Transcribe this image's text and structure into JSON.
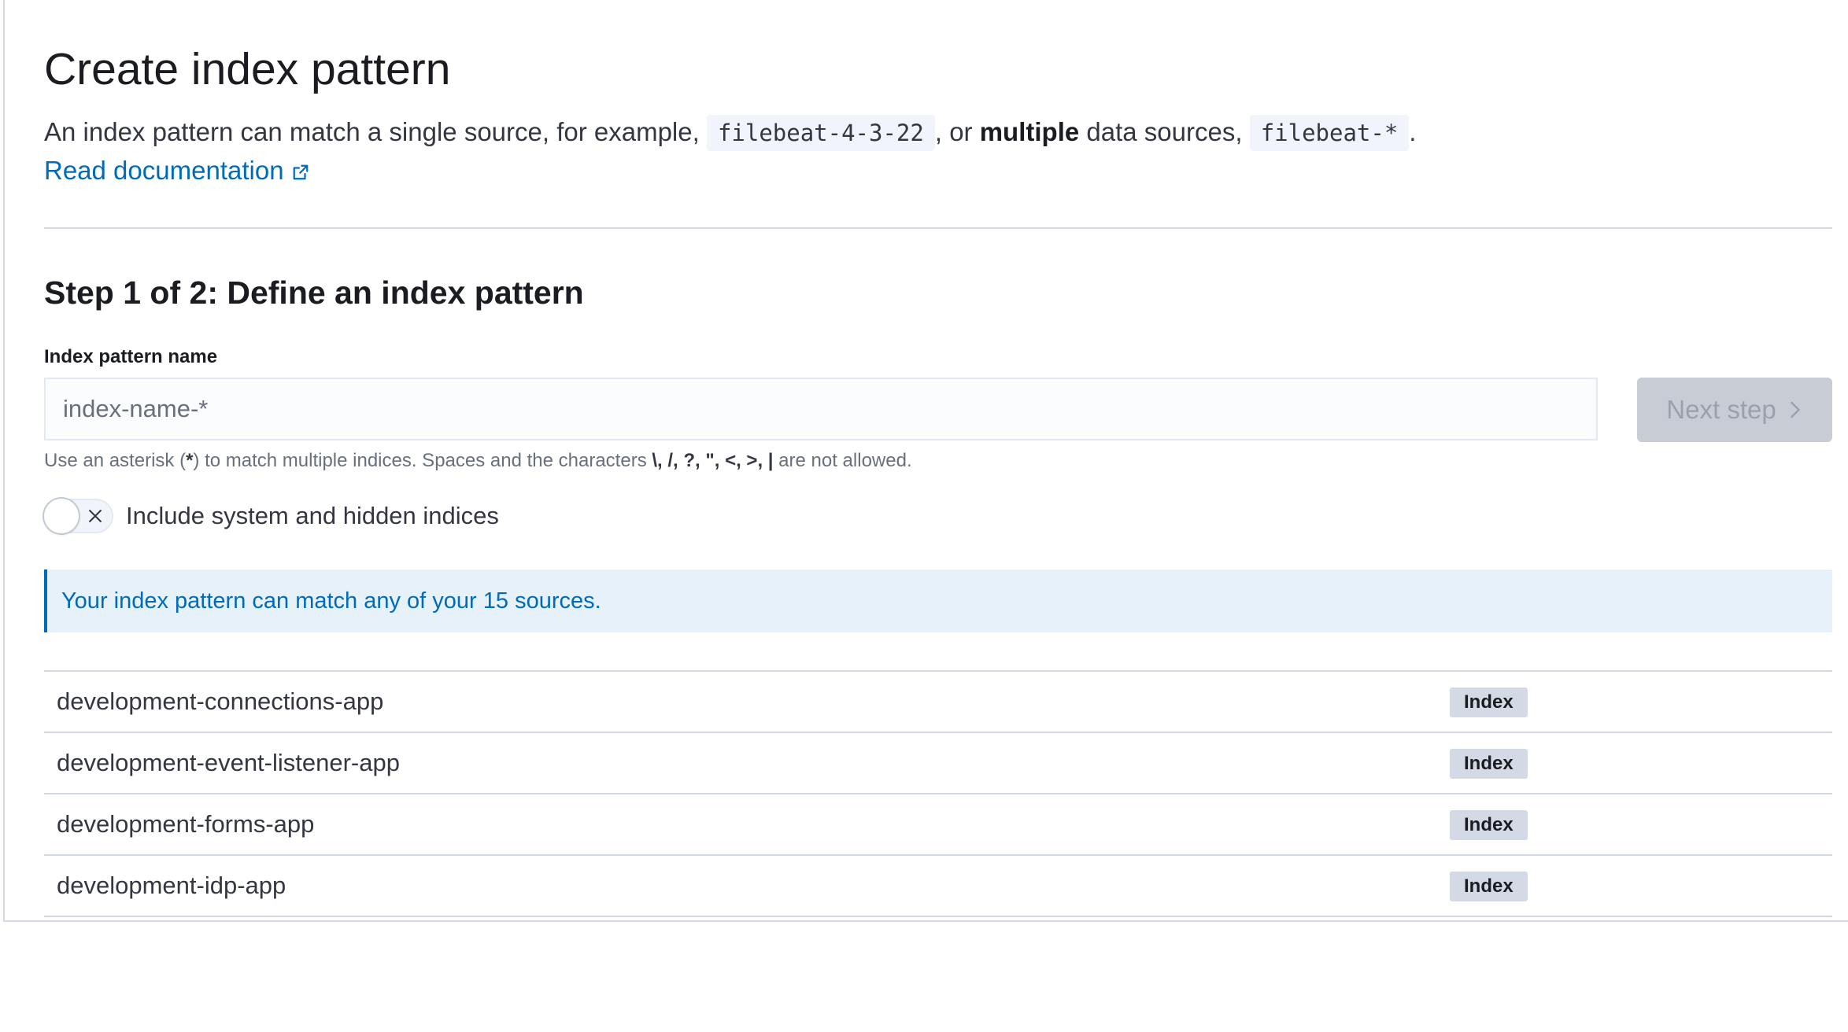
{
  "header": {
    "title": "Create index pattern",
    "desc_prefix": "An index pattern can match a single source, for example, ",
    "example_single": "filebeat-4-3-22",
    "desc_or": ", or ",
    "desc_multiple": "multiple",
    "desc_middle": " data sources, ",
    "example_multiple": "filebeat-*",
    "desc_end": ".",
    "doc_link": "Read documentation",
    "doc_link_icon": "external-link-icon"
  },
  "step": {
    "title": "Step 1 of 2: Define an index pattern",
    "field_label": "Index pattern name",
    "input_placeholder": "index-name-*",
    "input_value": "",
    "next_button": "Next step",
    "next_button_icon": "chevron-right-icon",
    "help_prefix": "Use an asterisk (",
    "help_asterisk": "*",
    "help_middle": ") to match multiple indices. Spaces and the characters ",
    "help_chars": "\\, /, ?, \", <, >, |",
    "help_suffix": " are not allowed."
  },
  "toggle": {
    "label": "Include system and hidden indices",
    "checked": false,
    "icon": "x-icon"
  },
  "callout": {
    "text": "Your index pattern can match any of your 15 sources."
  },
  "sources": [
    {
      "name": "development-connections-app",
      "type": "Index"
    },
    {
      "name": "development-event-listener-app",
      "type": "Index"
    },
    {
      "name": "development-forms-app",
      "type": "Index"
    },
    {
      "name": "development-idp-app",
      "type": "Index"
    }
  ],
  "colors": {
    "link": "#006bb8",
    "callout_bg": "#e6f1fa",
    "badge_bg": "#d3dae6",
    "disabled_button_bg": "#c8cdd5"
  }
}
